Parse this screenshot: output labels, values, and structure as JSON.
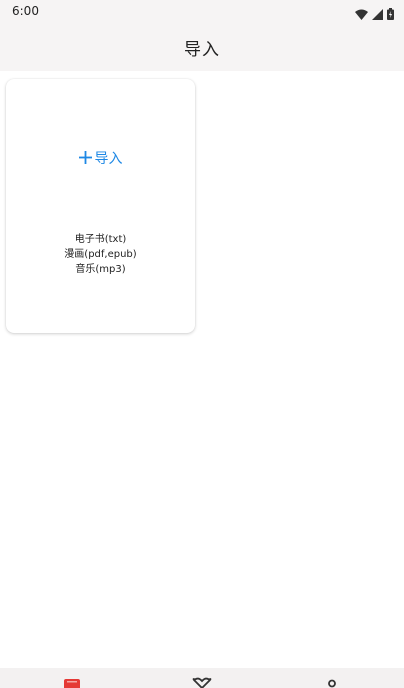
{
  "status_bar": {
    "time": "6:00",
    "icons": [
      "wifi-icon",
      "cellular-signal-icon",
      "battery-icon"
    ]
  },
  "app_bar": {
    "title": "导入"
  },
  "import_card": {
    "action_label": "导入",
    "action_icon": "plus-icon",
    "formats": [
      "电子书(txt)",
      "漫画(pdf,epub)",
      "音乐(mp3)"
    ]
  },
  "bottom_nav": {
    "items": [
      {
        "icon": "book-icon",
        "color": "#e53935"
      },
      {
        "icon": "heart-icon",
        "color": "#333333"
      },
      {
        "icon": "person-icon",
        "color": "#333333"
      }
    ]
  },
  "colors": {
    "accent": "#1e88e5",
    "bar_background": "#f6f4f4",
    "active_nav": "#e53935"
  }
}
